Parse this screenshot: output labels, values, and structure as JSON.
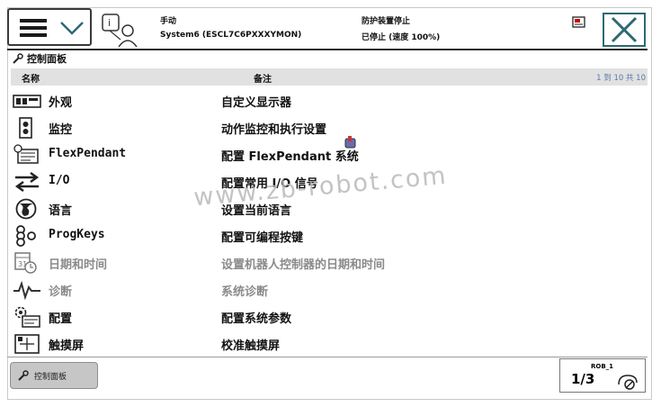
{
  "header": {
    "mode": "手动",
    "system": "System6 (ESCL7C6PXXXYMON)",
    "safety": "防护装置停止",
    "state": "已停止 (速度 100%)"
  },
  "panel": {
    "title": "控制面板"
  },
  "table": {
    "col_name": "名称",
    "col_desc": "备注",
    "paging": "1 到 10 共 10",
    "rows": [
      {
        "name": "外观",
        "desc": "自定义显示器",
        "icon": "appearance-icon",
        "dim": false
      },
      {
        "name": "监控",
        "desc": "动作监控和执行设置",
        "icon": "supervision-icon",
        "dim": false
      },
      {
        "name": "FlexPendant",
        "desc": "配置 FlexPendant 系统",
        "icon": "flexpendant-icon",
        "dim": false
      },
      {
        "name": "I/O",
        "desc": "配置常用 I/O 信号",
        "icon": "io-icon",
        "dim": false
      },
      {
        "name": "语言",
        "desc": "设置当前语言",
        "icon": "globe-icon",
        "dim": false
      },
      {
        "name": "ProgKeys",
        "desc": "配置可编程按键",
        "icon": "progkeys-icon",
        "dim": false
      },
      {
        "name": "日期和时间",
        "desc": "设置机器人控制器的日期和时间",
        "icon": "calendar-clock-icon",
        "dim": true
      },
      {
        "name": "诊断",
        "desc": "系统诊断",
        "icon": "diagnostics-icon",
        "dim": true
      },
      {
        "name": "配置",
        "desc": "配置系统参数",
        "icon": "configuration-icon",
        "dim": false
      },
      {
        "name": "触摸屏",
        "desc": "校准触摸屏",
        "icon": "touchscreen-icon",
        "dim": false
      }
    ]
  },
  "watermark": "www.zb-robot.com",
  "taskbar": {
    "item": "控制面板"
  },
  "robot": {
    "label": "ROB_1",
    "fraction": "1/3"
  },
  "colors": {
    "accent": "#2c6a73",
    "header_bg": "#e1e1e1",
    "paging_text": "#5a78b0"
  }
}
